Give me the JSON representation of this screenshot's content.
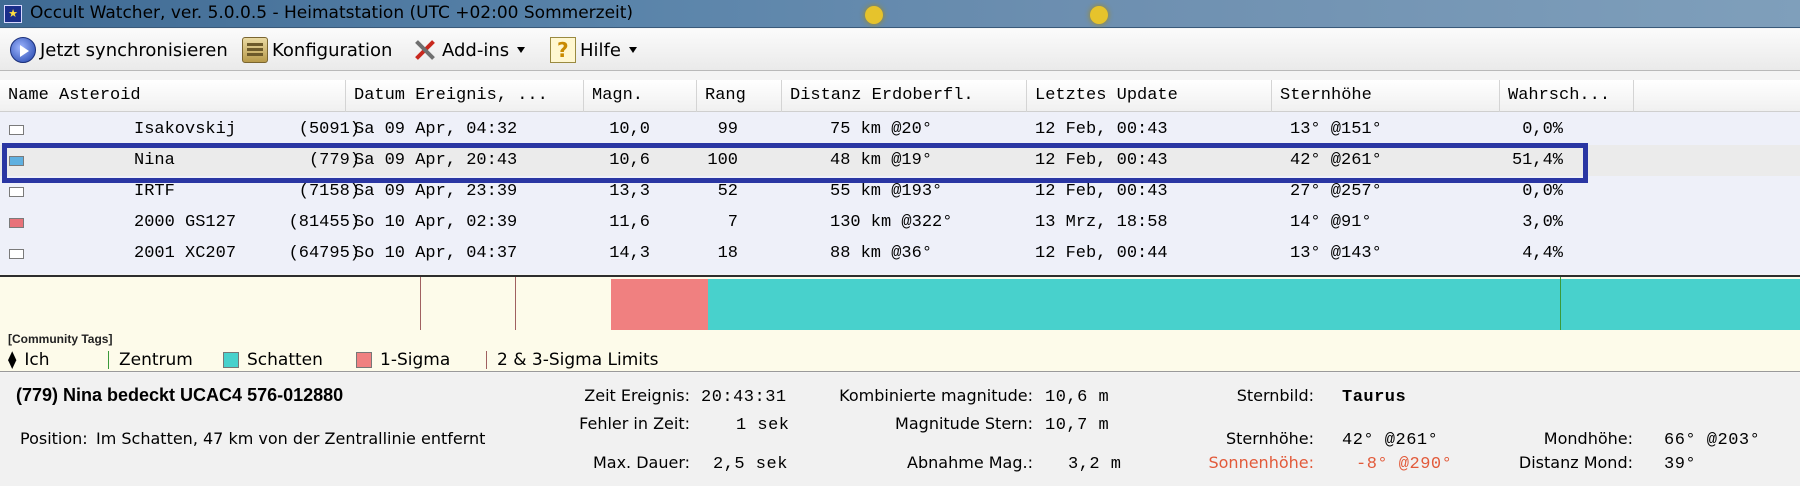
{
  "window": {
    "title": "Occult Watcher, ver. 5.0.0.5 - Heimatstation (UTC +02:00 Sommerzeit)"
  },
  "toolbar": {
    "sync_label": "Jetzt synchronisieren",
    "config_label": "Konfiguration",
    "addins_label": "Add-ins",
    "help_label": "Hilfe"
  },
  "table": {
    "columns": [
      "Name Asteroid",
      "Datum Ereignis, ...",
      "Magn.",
      "Rang",
      "Distanz Erdoberfl.",
      "Letztes Update",
      "Sternhöhe",
      "Wahrsch..."
    ],
    "selected_index": 1,
    "rows": [
      {
        "swatch": "#ffffff",
        "name": "(5091) Isakovskij",
        "date": "Sa 09 Apr, 04:32",
        "magn": "10,0",
        "rank": "99",
        "distance": "75 km @20°",
        "update": "12 Feb, 00:43",
        "starheight": "13° @151°",
        "prob": "0,0%"
      },
      {
        "swatch": "#5fb0e0",
        "name": "(779) Nina",
        "date": "Sa 09 Apr, 20:43",
        "magn": "10,6",
        "rank": "100",
        "distance": "48 km @19°",
        "update": "12 Feb, 00:43",
        "starheight": "42° @261°",
        "prob": "51,4%"
      },
      {
        "swatch": "#ffffff",
        "name": "(7158) IRTF",
        "date": "Sa 09 Apr, 23:39",
        "magn": "13,3",
        "rank": "52",
        "distance": "55 km @193°",
        "update": "12 Feb, 00:43",
        "starheight": "27° @257°",
        "prob": "0,0%"
      },
      {
        "swatch": "#e8727a",
        "name": "(81455) 2000 GS127",
        "date": "So 10 Apr, 02:39",
        "magn": "11,6",
        "rank": "7",
        "distance": "130 km @322°",
        "update": "13 Mrz, 18:58",
        "starheight": "14° @91°",
        "prob": "3,0%"
      },
      {
        "swatch": "#ffffff",
        "name": "(64795) 2001 XC207",
        "date": "So 10 Apr, 04:37",
        "magn": "14,3",
        "rank": "18",
        "distance": "88 km @36°",
        "update": "12 Feb, 00:44",
        "starheight": "13° @143°",
        "prob": "4,4%"
      }
    ]
  },
  "legend": {
    "header": "[Community Tags]",
    "items": [
      {
        "label": "Ich",
        "glyph": "⧫"
      },
      {
        "label": "Zentrum",
        "color": "#3a9a3a"
      },
      {
        "label": "Schatten",
        "color": "#48d1cc"
      },
      {
        "label": "1-Sigma",
        "color": "#f08080"
      },
      {
        "label": "2 & 3-Sigma Limits",
        "color": "#a06060"
      }
    ]
  },
  "details": {
    "title": "(779) Nina bedeckt UCAC4 576-012880",
    "position_label": "Position:",
    "position_value": "Im Schatten, 47 km von der Zentrallinie entfernt",
    "zeit_label": "Zeit Ereignis:",
    "zeit_value": "20:43:31",
    "fehler_label": "Fehler in Zeit:",
    "fehler_value": "1 sek",
    "dauer_label": "Max. Dauer:",
    "dauer_value": "2,5 sek",
    "kombmag_label": "Kombinierte magnitude:",
    "kombmag_value": "10,6 m",
    "magstern_label": "Magnitude Stern:",
    "magstern_value": "10,7 m",
    "abnahme_label": "Abnahme Mag.:",
    "abnahme_value": "3,2 m",
    "sternbild_label": "Sternbild:",
    "sternbild_value": "Taurus",
    "sternhoehe_label": "Sternhöhe:",
    "sternhoehe_value": "42° @261°",
    "sonnenhoehe_label": "Sonnenhöhe:",
    "sonnenhoehe_value": "-8° @290°",
    "mondhoehe_label": "Mondhöhe:",
    "mondhoehe_value": "66° @203°",
    "distmond_label": "Distanz Mond:",
    "distmond_value": "39°"
  },
  "colors": {
    "selection_frame": "#2a36a3",
    "sigma1": "#f08080",
    "shadow": "#48d1cc",
    "sun_warning": "#e25a3a"
  }
}
